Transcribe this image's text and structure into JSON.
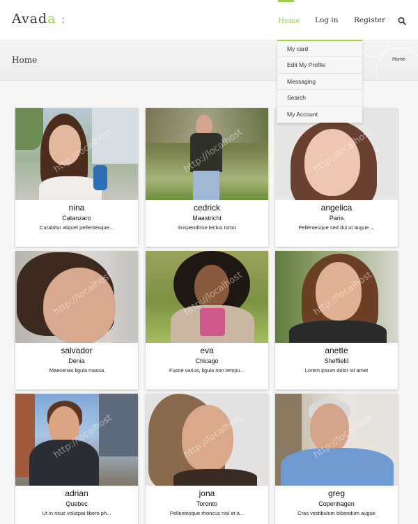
{
  "header": {
    "logo_text": "Avada",
    "logo_accent": "a",
    "logo_suffix": ":",
    "nav": {
      "home": "Home",
      "login": "Log in",
      "register": "Register"
    },
    "search_icon": "search-icon"
  },
  "titlebar": {
    "title": "Home",
    "breadcrumb": "Home"
  },
  "dropdown": {
    "items": [
      "My card",
      "Edit My Profile",
      "Messaging",
      "Search",
      "My Account"
    ]
  },
  "colors": {
    "accent": "#a0ce4e",
    "background": "#f6f6f6",
    "card": "#ffffff"
  },
  "watermark": "http://localhost",
  "cards": [
    {
      "name": "nina",
      "city": "Catanzaro",
      "desc": "Curabitur aliquet pellentesque..."
    },
    {
      "name": "cedrick",
      "city": "Maastricht",
      "desc": "Suspendisse lectus tortor"
    },
    {
      "name": "angelica",
      "city": "Paris",
      "desc": "Pellentesque sed dui ut augue ..."
    },
    {
      "name": "salvador",
      "city": "Denia",
      "desc": "Maecenas ligula massa"
    },
    {
      "name": "eva",
      "city": "Chicago",
      "desc": "Fusce varius, ligula non tempu..."
    },
    {
      "name": "anette",
      "city": "Sheffield",
      "desc": "Lorem ipsum dolor sit amet"
    },
    {
      "name": "adrian",
      "city": "Quebec",
      "desc": "Ut in risus volutpat libero ph..."
    },
    {
      "name": "jona",
      "city": "Toronto",
      "desc": "Pellentesque rhoncus nisl et a..."
    },
    {
      "name": "greg",
      "city": "Copenhagen",
      "desc": "Cras vestibulum bibendum augue"
    }
  ]
}
